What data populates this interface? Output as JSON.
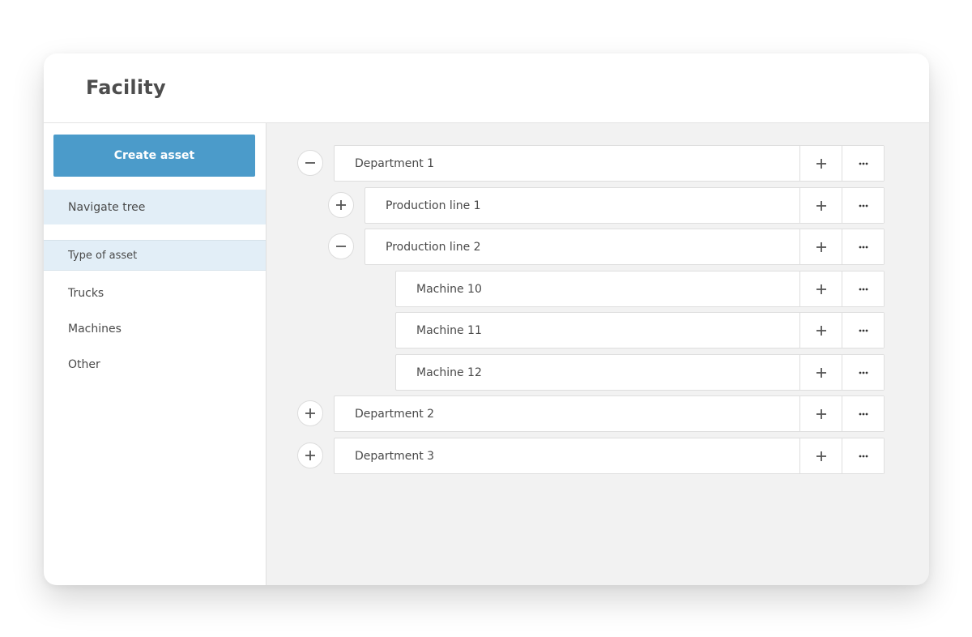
{
  "header": {
    "title": "Facility"
  },
  "sidebar": {
    "create_button": "Create asset",
    "navigate_tree": "Navigate tree",
    "type_of_asset_heading": "Type of asset",
    "asset_types": [
      "Trucks",
      "Machines",
      "Other"
    ]
  },
  "colors": {
    "primary": "#4b9bca",
    "selected_bg": "#e2eef7",
    "content_bg": "#f2f2f2"
  },
  "tree": [
    {
      "label": "Department 1",
      "level": 0,
      "toggle": "collapse",
      "toggle_icon": "minus-icon"
    },
    {
      "label": "Production line 1",
      "level": 1,
      "toggle": "expand",
      "toggle_icon": "plus-icon"
    },
    {
      "label": "Production line 2",
      "level": 1,
      "toggle": "collapse",
      "toggle_icon": "minus-icon"
    },
    {
      "label": "Machine 10",
      "level": 2,
      "toggle": null
    },
    {
      "label": "Machine 11",
      "level": 2,
      "toggle": null
    },
    {
      "label": "Machine 12",
      "level": 2,
      "toggle": null
    },
    {
      "label": "Department 2",
      "level": 0,
      "toggle": "expand",
      "toggle_icon": "plus-icon"
    },
    {
      "label": "Department 3",
      "level": 0,
      "toggle": "expand",
      "toggle_icon": "plus-icon"
    }
  ],
  "row_actions": {
    "add_icon": "plus-icon",
    "more_icon": "ellipsis-icon"
  }
}
